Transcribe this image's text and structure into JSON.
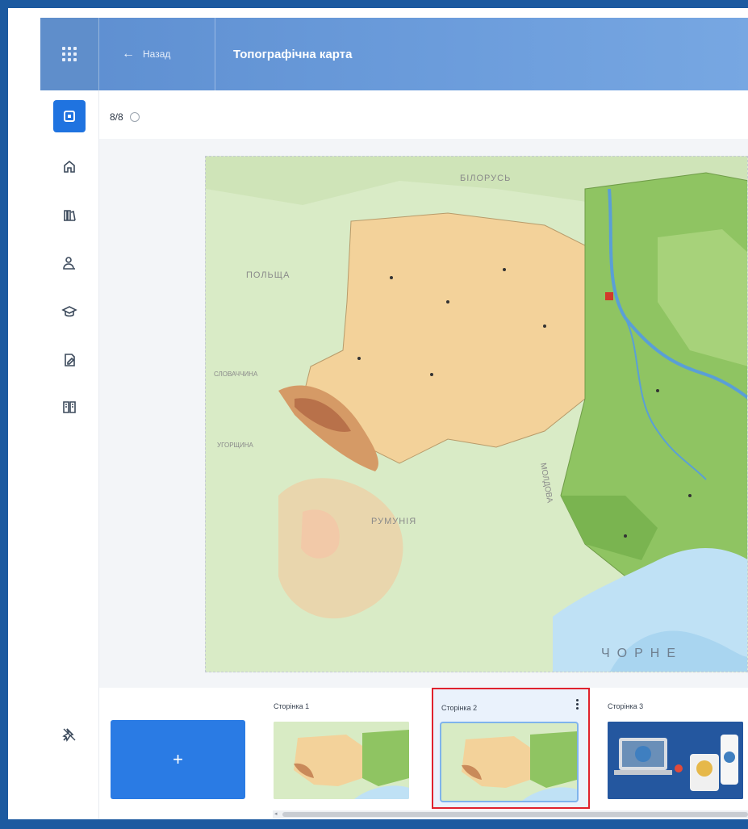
{
  "header": {
    "back_label": "Назад",
    "title": "Топографічна карта"
  },
  "page_indicator": "8/8",
  "rail": {
    "items": [
      {
        "icon": "add-page-icon",
        "active": true
      },
      {
        "icon": "home-icon"
      },
      {
        "icon": "library-icon"
      },
      {
        "icon": "users-icon"
      },
      {
        "icon": "graduation-cap-icon"
      },
      {
        "icon": "document-edit-icon"
      },
      {
        "icon": "book-icon"
      }
    ],
    "bottom_icon": "pin-off-icon"
  },
  "map": {
    "labels": [
      "БІЛОРУСЬ",
      "ПОЛЬЩА",
      "СЛОВАЧЧИНА",
      "УГОРЩИНА",
      "РУМУНІЯ",
      "МОЛДОВА",
      "ЧОРНЕ"
    ]
  },
  "thumbnails": [
    {
      "label": "Сторінка 1",
      "selected": false
    },
    {
      "label": "Сторінка 2",
      "selected": true
    },
    {
      "label": "Сторінка 3",
      "selected": false
    }
  ],
  "add_button_label": "+",
  "colors": {
    "accent": "#2a7be4",
    "header": "#6c9ddc",
    "selection": "#e0222d"
  }
}
